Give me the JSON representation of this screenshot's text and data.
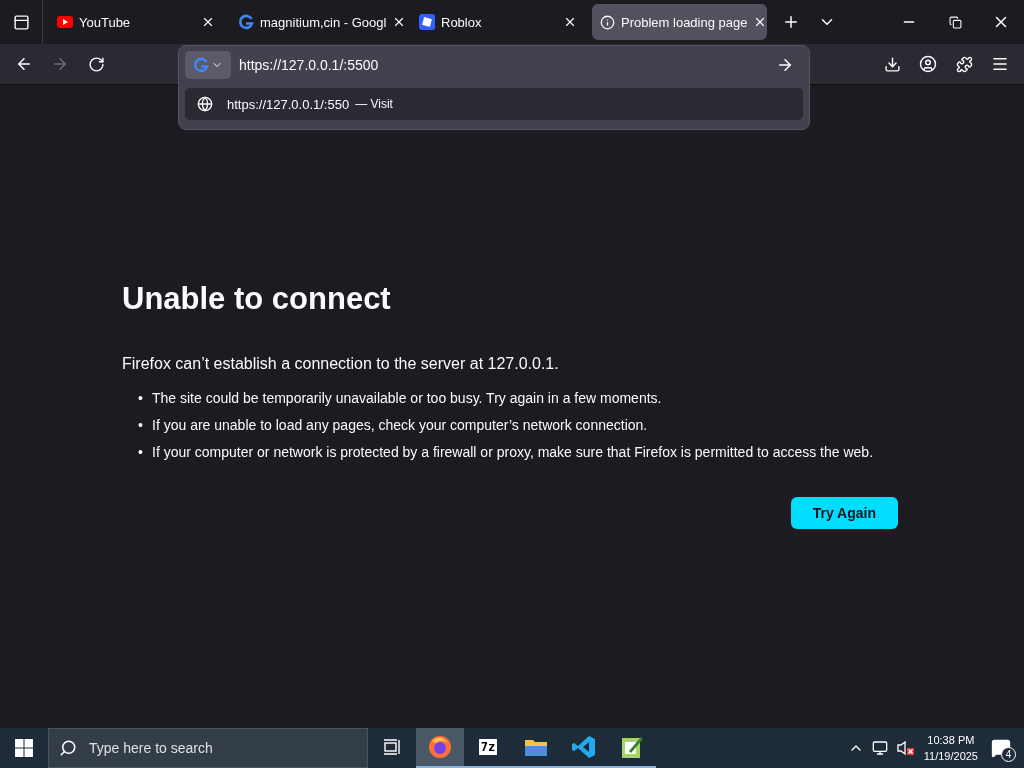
{
  "tabs": [
    {
      "title": "YouTube",
      "kind": "youtube",
      "selected": false
    },
    {
      "title": "magnitium,cin - Googl",
      "kind": "google",
      "selected": false
    },
    {
      "title": "Roblox",
      "kind": "roblox",
      "selected": false
    },
    {
      "title": "Problem loading page",
      "kind": "info",
      "selected": true
    }
  ],
  "urlbar": {
    "value": "https://127.0.0.1/:5500",
    "suggestion": {
      "url": "https://127.0.0.1/:550",
      "separator": "—",
      "action": "Visit"
    }
  },
  "error": {
    "title": "Unable to connect",
    "message": "Firefox can’t establish a connection to the server at 127.0.0.1.",
    "bullets": [
      {
        "marker": "•",
        "text": "The site could be temporarily unavailable or too busy. Try again in a few moments."
      },
      {
        "marker": "•",
        "text": "If you are unable to load any pages, check your computer’s network connection."
      },
      {
        "marker": "•",
        "text": "If your computer or network is protected by a firewall or proxy, make sure that Firefox is permitted to access the web."
      }
    ],
    "button": "Try Again"
  },
  "taskbar": {
    "search_placeholder": "Type here to search",
    "apps": [
      {
        "kind": "firefox",
        "running": true,
        "selected": true
      },
      {
        "kind": "archiver",
        "label": "7z",
        "running": true,
        "selected": false
      },
      {
        "kind": "folder",
        "running": true,
        "selected": false
      },
      {
        "kind": "code",
        "running": true,
        "selected": false
      },
      {
        "kind": "notepad",
        "running": true,
        "selected": false
      }
    ],
    "time": "10:38 PM",
    "date": "11/19/2025",
    "notifications": "4"
  }
}
